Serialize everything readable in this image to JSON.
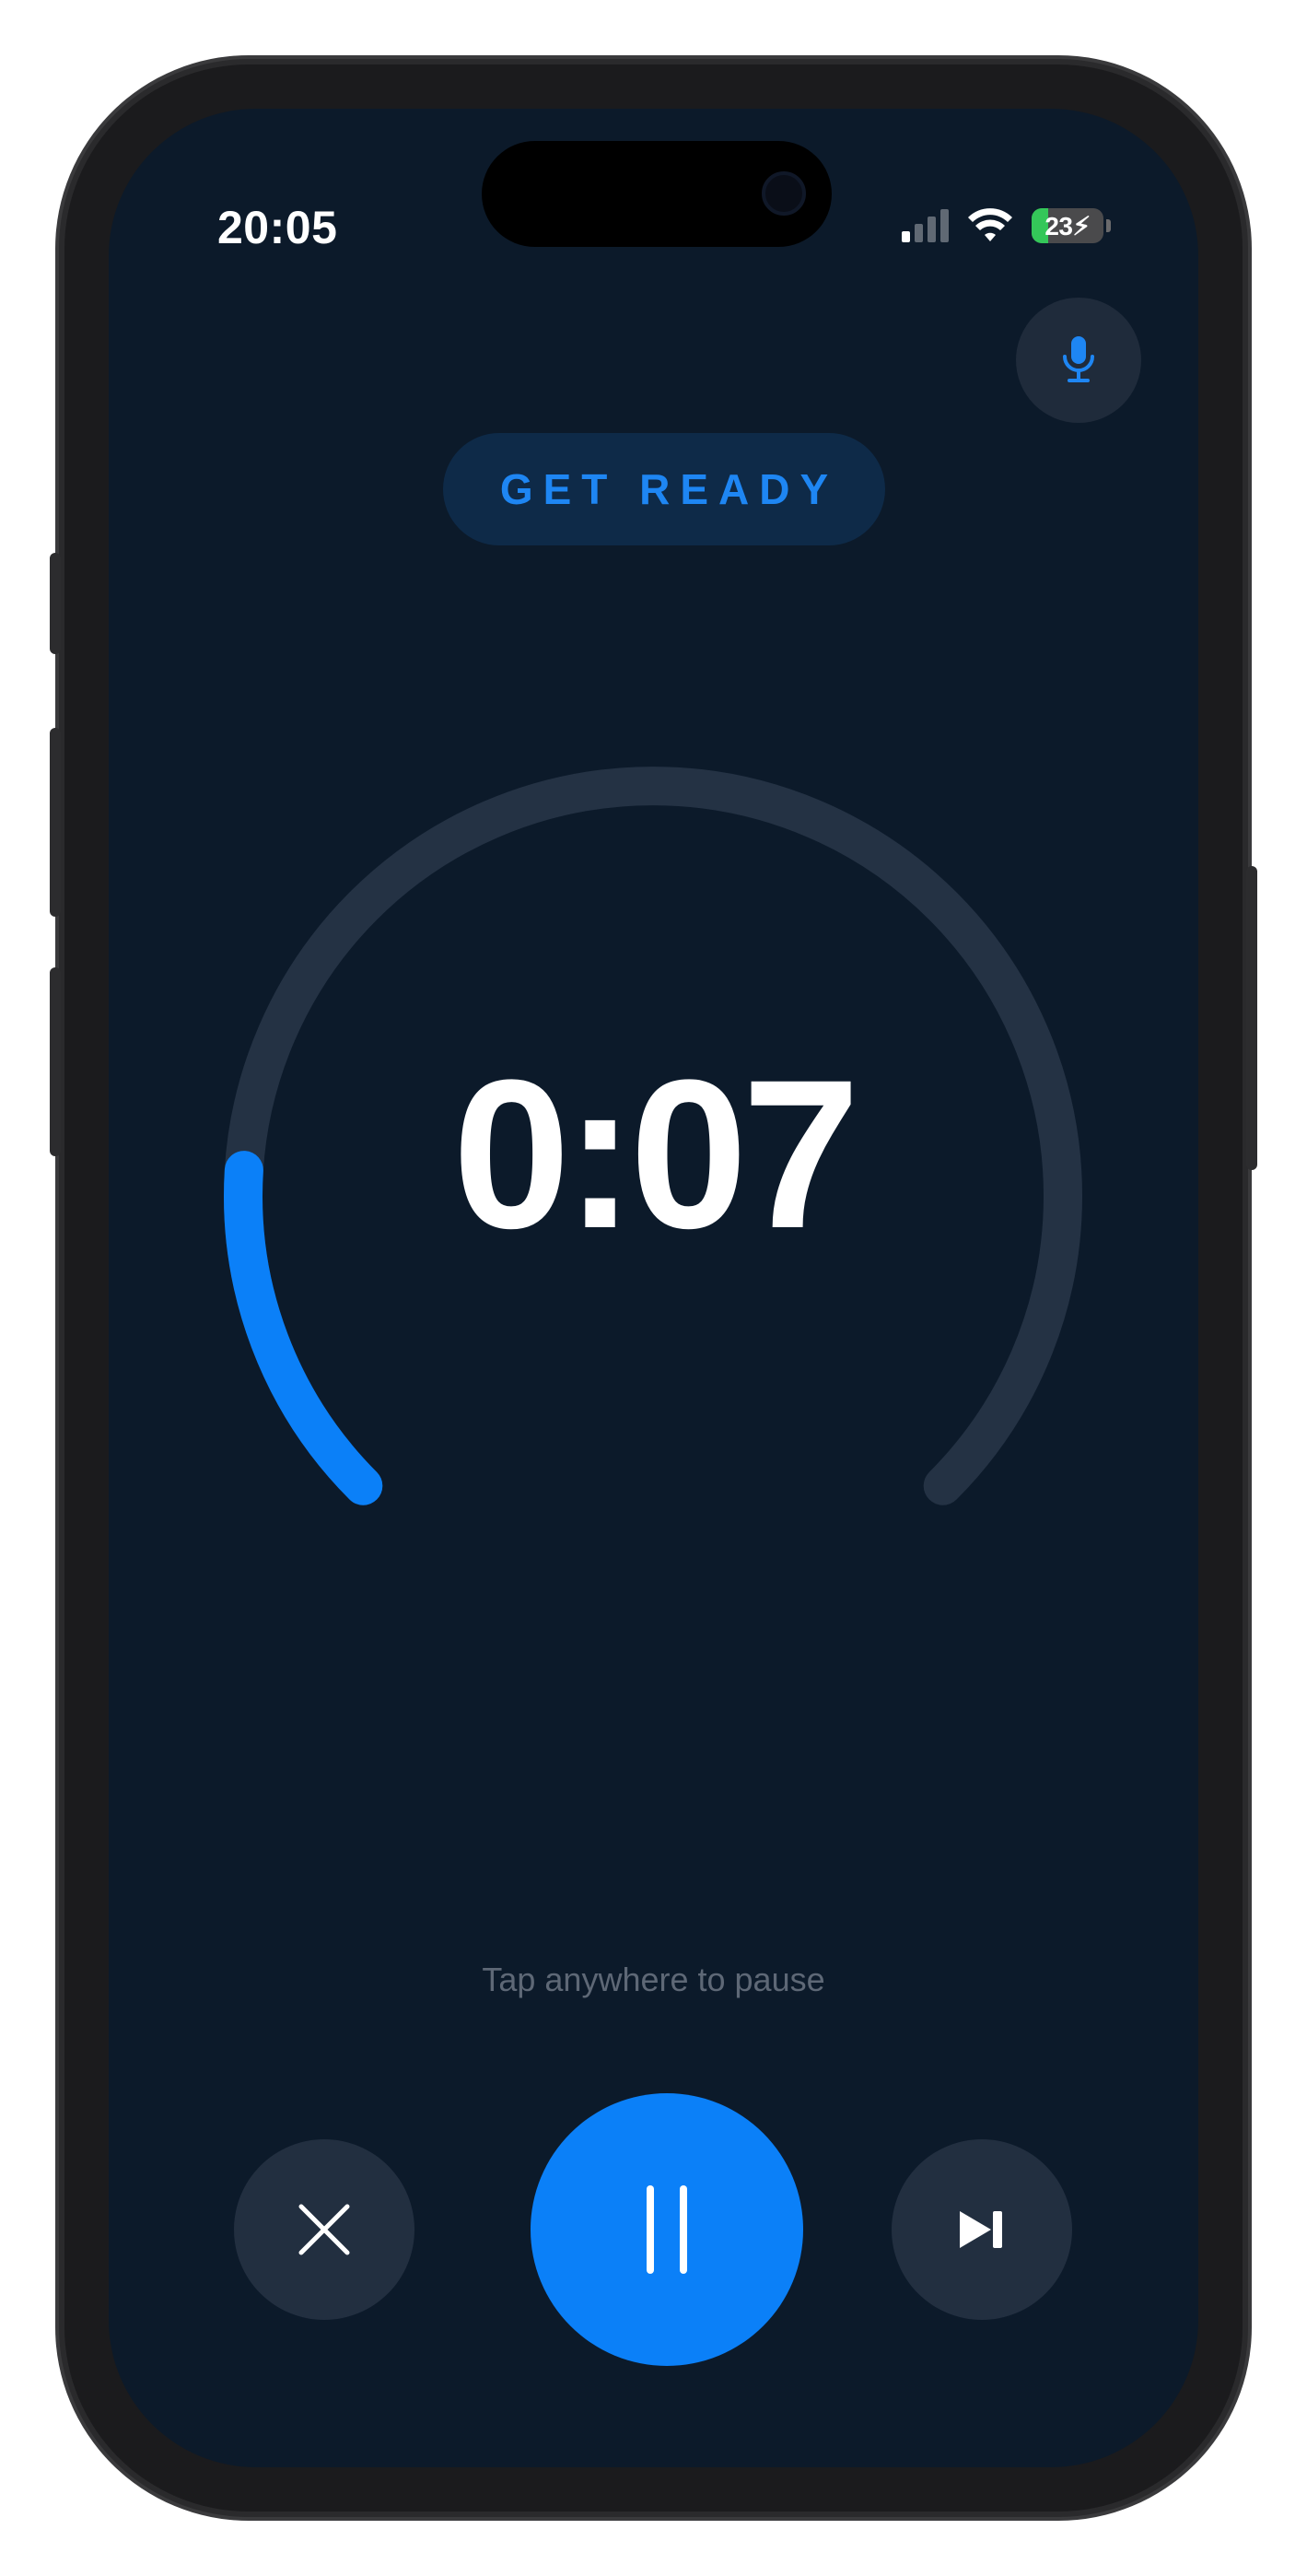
{
  "status_bar": {
    "time": "20:05",
    "battery": "23",
    "battery_level": 0.23,
    "icons": [
      "cellular-signal-icon",
      "wifi-icon",
      "battery-charging-icon"
    ]
  },
  "header": {
    "mic_icon": "microphone-icon"
  },
  "phase": {
    "label": "GET READY"
  },
  "timer": {
    "display": "0:07",
    "progress": 0.18,
    "track_color": "#243244",
    "progress_color": "#0b80f8"
  },
  "hint": "Tap anywhere to pause",
  "controls": {
    "close_icon": "close-icon",
    "pause_icon": "pause-icon",
    "skip_icon": "skip-forward-icon"
  },
  "colors": {
    "background": "#0c1a2a",
    "accent": "#0b80f8",
    "pill_bg": "#0e2a48",
    "button_bg": "#222f40"
  }
}
